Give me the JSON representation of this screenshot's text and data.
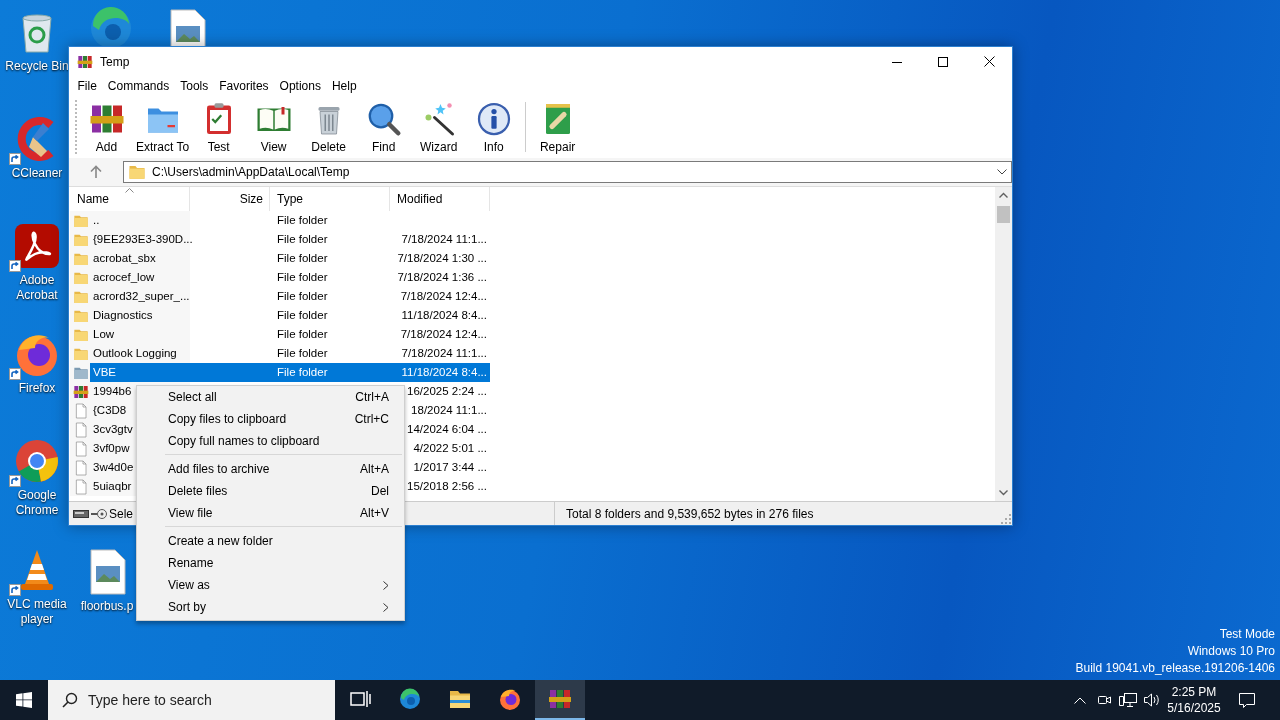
{
  "desktop_icons": [
    {
      "kind": "recycle-bin",
      "label": "Recycle Bin",
      "shortcut": false
    },
    {
      "kind": "browser",
      "shortcut": false
    },
    {
      "kind": "image-file",
      "shortcut": false
    },
    {
      "kind": "ccleaner",
      "label": "CCleaner",
      "shortcut": true
    },
    {
      "kind": "acrobat",
      "label": "Adobe Acrobat",
      "shortcut": true
    },
    {
      "kind": "firefox",
      "label": "Firefox",
      "shortcut": true
    },
    {
      "kind": "chrome",
      "label": "Google Chrome",
      "shortcut": true
    },
    {
      "kind": "vlc",
      "label": "VLC media player",
      "shortcut": true
    },
    {
      "kind": "image-file",
      "label": "floorbus.p",
      "shortcut": false
    }
  ],
  "window": {
    "title": "Temp",
    "menu": [
      "File",
      "Commands",
      "Tools",
      "Favorites",
      "Options",
      "Help"
    ],
    "toolbar": [
      [
        {
          "kind": "add",
          "label": "Add"
        },
        {
          "kind": "extract",
          "label": "Extract To"
        },
        {
          "kind": "test",
          "label": "Test"
        },
        {
          "kind": "view",
          "label": "View"
        },
        {
          "kind": "delete",
          "label": "Delete"
        },
        {
          "kind": "find",
          "label": "Find"
        },
        {
          "kind": "wizard",
          "label": "Wizard"
        },
        {
          "kind": "info",
          "label": "Info"
        }
      ],
      [
        {
          "kind": "repair",
          "label": "Repair"
        }
      ]
    ],
    "address": "C:\\Users\\admin\\AppData\\Local\\Temp",
    "columns": [
      {
        "label": "Name",
        "sorted": true
      },
      {
        "label": "Size",
        "sorted": false
      },
      {
        "label": "Type",
        "sorted": false
      },
      {
        "label": "Modified",
        "sorted": false
      }
    ],
    "rows": [
      {
        "kind": "folder",
        "name": "..",
        "type": "File folder",
        "selected": false
      },
      {
        "kind": "folder",
        "name": "{9EE293E3-390D...",
        "type": "File folder",
        "modified": "7/18/2024 11:1...",
        "selected": false
      },
      {
        "kind": "folder",
        "name": "acrobat_sbx",
        "type": "File folder",
        "modified": "7/18/2024 1:30 ...",
        "selected": false
      },
      {
        "kind": "folder",
        "name": "acrocef_low",
        "type": "File folder",
        "modified": "7/18/2024 1:36 ...",
        "selected": false
      },
      {
        "kind": "folder",
        "name": "acrord32_super_...",
        "type": "File folder",
        "modified": "7/18/2024 12:4...",
        "selected": false
      },
      {
        "kind": "folder",
        "name": "Diagnostics",
        "type": "File folder",
        "modified": "11/18/2024 8:4...",
        "selected": false
      },
      {
        "kind": "folder",
        "name": "Low",
        "type": "File folder",
        "modified": "7/18/2024 12:4...",
        "selected": false
      },
      {
        "kind": "folder",
        "name": "Outlook Logging",
        "type": "File folder",
        "modified": "7/18/2024 11:1...",
        "selected": false
      },
      {
        "kind": "folder",
        "name": "VBE",
        "type": "File folder",
        "modified": "11/18/2024 8:4...",
        "selected": true
      },
      {
        "kind": "archive",
        "name": "1994b6",
        "modified": "16/2025 2:24 ...",
        "selected": false
      },
      {
        "kind": "file",
        "name": "{C3D8",
        "modified": "18/2024 11:1...",
        "selected": false
      },
      {
        "kind": "file",
        "name": "3cv3gtv",
        "modified": "14/2024 6:04 ...",
        "selected": false
      },
      {
        "kind": "file",
        "name": "3vf0pw",
        "modified": "4/2022 5:01 ...",
        "selected": false
      },
      {
        "kind": "file",
        "name": "3w4d0e",
        "modified": "1/2017 3:44 ...",
        "selected": false
      },
      {
        "kind": "file",
        "name": "5uiaqbr",
        "modified": "15/2018 2:56 ...",
        "selected": false
      }
    ],
    "status": {
      "selection": "Sele",
      "total": "Total 8 folders and 9,539,652 bytes in 276 files"
    }
  },
  "context_menu": {
    "groups": [
      [
        {
          "label": "Select all",
          "shortcut": "Ctrl+A",
          "submenu": false
        },
        {
          "label": "Copy files to clipboard",
          "shortcut": "Ctrl+C",
          "submenu": false
        },
        {
          "label": "Copy full names to clipboard",
          "submenu": false
        }
      ],
      [
        {
          "label": "Add files to archive",
          "shortcut": "Alt+A",
          "submenu": false
        },
        {
          "label": "Delete files",
          "shortcut": "Del",
          "submenu": false
        },
        {
          "label": "View file",
          "shortcut": "Alt+V",
          "submenu": false
        }
      ],
      [
        {
          "label": "Create a new folder",
          "submenu": false
        },
        {
          "label": "Rename",
          "submenu": false
        },
        {
          "label": "View as",
          "submenu": true
        },
        {
          "label": "Sort by",
          "submenu": true
        }
      ]
    ]
  },
  "system_notice": [
    "Test Mode",
    "Windows 10 Pro",
    "Build 19041.vb_release.191206-1406"
  ],
  "taskbar": {
    "search_placeholder": "Type here to search",
    "apps": [
      {
        "kind": "task-view",
        "active": false
      },
      {
        "kind": "browser",
        "active": false
      },
      {
        "kind": "file-explorer",
        "active": false
      },
      {
        "kind": "firefox",
        "active": false
      },
      {
        "kind": "archive",
        "active": true
      }
    ],
    "time": "2:25 PM",
    "date": "5/16/2025"
  }
}
